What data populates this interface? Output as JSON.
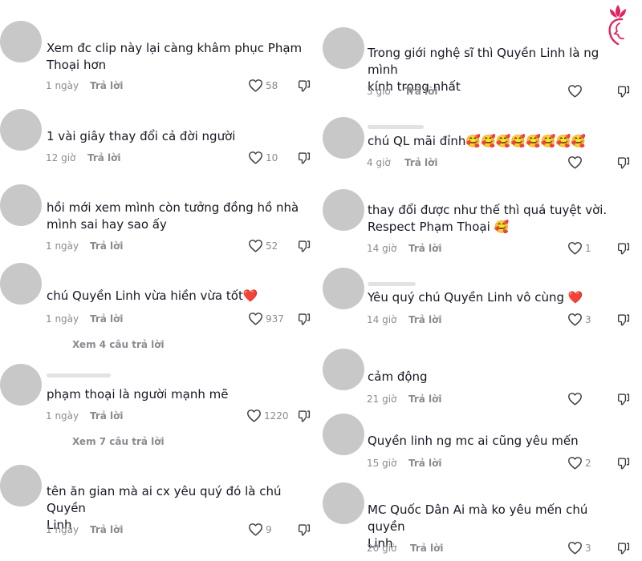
{
  "left_comments": [
    {
      "text": "Xem đc clip này lại càng khâm phục Phạm\nThoại hơn",
      "time": "1 ngày",
      "reply": "Trả lời",
      "likes": "58"
    },
    {
      "text": "1 vài giây thay đổi cả đời người",
      "time": "12 giờ",
      "reply": "Trả lời",
      "likes": "10"
    },
    {
      "text": "hồi mới xem mình còn tưởng đồng hồ nhà\nmình sai hay sao ấy",
      "time": "1 ngày",
      "reply": "Trả lời",
      "likes": "52"
    },
    {
      "text": "chú Quyền Linh vừa hiền vừa tốt❤️",
      "time": "1 ngày",
      "reply": "Trả lời",
      "likes": "937",
      "more": "Xem 4 câu trả lời"
    },
    {
      "text": "phạm thoại là người mạnh mẽ",
      "time": "1 ngày",
      "reply": "Trả lời",
      "likes": "1220",
      "more": "Xem 7 câu trả lời"
    },
    {
      "text": "tên ăn gian mà ai cx yêu quý đó là chú Quyền\nLinh",
      "time": "1 ngày",
      "reply": "Trả lời",
      "likes": "9"
    }
  ],
  "right_comments": [
    {
      "text": "Trong giới nghệ sĩ thì Quyền Linh là ng mình\nkính trọng nhất",
      "time": "3 giờ",
      "reply": "Trả lời",
      "likes": ""
    },
    {
      "text": "chú QL mãi đỉnh🥰🥰🥰🥰🥰🥰🥰🥰",
      "time": "4 giờ",
      "reply": "Trả lời",
      "likes": ""
    },
    {
      "text": "thay đổi được như thế thì quá tuyệt vời.\nRespect Phạm Thoại 🥰",
      "time": "14 giờ",
      "reply": "Trả lời",
      "likes": "1"
    },
    {
      "text": "Yêu quý chú Quyền Linh vô cùng ❤️",
      "time": "14 giờ",
      "reply": "Trả lời",
      "likes": "3"
    },
    {
      "text": "cảm động",
      "time": "21 giờ",
      "reply": "Trả lời",
      "likes": ""
    },
    {
      "text": "Quyền linh ng mc ai cũng yêu mến",
      "time": "15 giờ",
      "reply": "Trả lời",
      "likes": "2"
    },
    {
      "text": "MC Quốc Dân Ai mà ko yêu mến chú quyền\nLinh",
      "time": "20 giờ",
      "reply": "Trả lời",
      "likes": "3"
    }
  ],
  "icons": {
    "like": "heart-outline-icon",
    "dislike": "thumb-down-outline-icon",
    "logo": "lotus-woman-logo"
  },
  "colors": {
    "text": "#161823",
    "muted": "#8a8b91",
    "avatar": "#c8c8c8",
    "logo": "#e0245e"
  }
}
